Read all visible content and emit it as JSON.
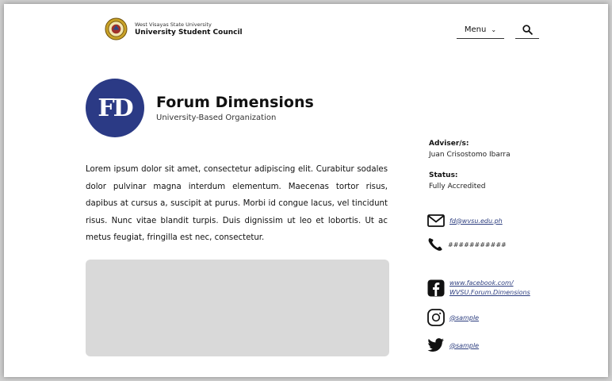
{
  "header": {
    "university": "West Visayas State University",
    "council": "University Student Council",
    "menu_label": "Menu"
  },
  "org": {
    "logo_text": "FD",
    "name": "Forum Dimensions",
    "type": "University-Based Organization",
    "description": "Lorem ipsum dolor sit amet, consectetur adipiscing elit. Curabitur sodales dolor pulvinar magna interdum elementum. Maecenas tortor risus, dapibus at cursus a, suscipit at purus. Morbi id congue lacus, vel tincidunt risus. Nunc vitae blandit turpis. Duis dignissim ut leo et lobortis. Ut ac metus feugiat, fringilla est nec, consectetur."
  },
  "sidebar": {
    "adviser_label": "Adviser/s:",
    "adviser_value": "Juan Crisostomo Ibarra",
    "status_label": "Status:",
    "status_value": "Fully Accredited",
    "email": "fd@wvsu.edu.ph",
    "phone": "###########",
    "facebook_line1": "www.facebook.com/",
    "facebook_line2": "WVSU.Forum.Dimensions",
    "instagram": "@sample",
    "twitter": "@sample"
  },
  "colors": {
    "brand_blue": "#2b3a85",
    "link": "#2e3f80",
    "placeholder": "#d9d9d9"
  },
  "icons": [
    "university-seal-icon",
    "chevron-down-icon",
    "search-icon",
    "mail-icon",
    "phone-icon",
    "facebook-icon",
    "instagram-icon",
    "twitter-icon"
  ]
}
